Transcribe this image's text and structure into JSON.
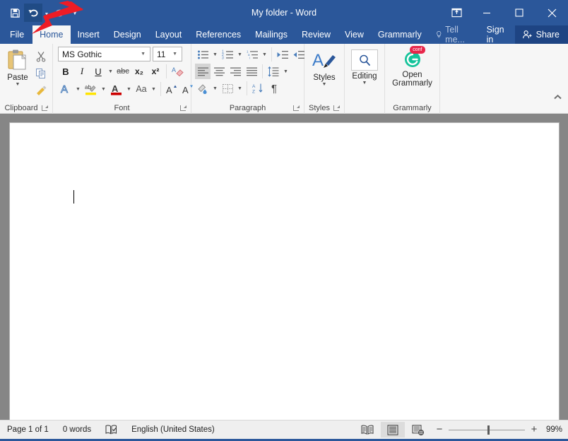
{
  "window": {
    "title": "My folder - Word",
    "quick_access": [
      {
        "name": "save-icon",
        "label": "Save"
      },
      {
        "name": "undo-icon",
        "label": "Undo"
      },
      {
        "name": "redo-icon",
        "label": "Redo"
      },
      {
        "name": "customize-qat-icon",
        "label": "Customize Quick Access Toolbar"
      }
    ],
    "controls": [
      {
        "name": "ribbon-display-options-icon",
        "label": "Ribbon Display Options",
        "glyph": "⤒"
      },
      {
        "name": "minimize-icon",
        "label": "Minimize",
        "glyph": "—"
      },
      {
        "name": "maximize-icon",
        "label": "Maximize",
        "glyph": "□"
      },
      {
        "name": "close-icon",
        "label": "Close",
        "glyph": "✕"
      }
    ]
  },
  "tabs": [
    {
      "label": "File",
      "active": false
    },
    {
      "label": "Home",
      "active": true
    },
    {
      "label": "Insert",
      "active": false
    },
    {
      "label": "Design",
      "active": false
    },
    {
      "label": "Layout",
      "active": false
    },
    {
      "label": "References",
      "active": false
    },
    {
      "label": "Mailings",
      "active": false
    },
    {
      "label": "Review",
      "active": false
    },
    {
      "label": "View",
      "active": false
    },
    {
      "label": "Grammarly",
      "active": false
    }
  ],
  "tabbar_right": {
    "tell_me": "Tell me...",
    "sign_in": "Sign in",
    "share": "Share"
  },
  "ribbon": {
    "groups": [
      {
        "label": "Clipboard",
        "has_launcher": true
      },
      {
        "label": "Font",
        "has_launcher": true
      },
      {
        "label": "Paragraph",
        "has_launcher": true
      },
      {
        "label": "Styles",
        "has_launcher": true
      },
      {
        "label": "Grammarly",
        "has_launcher": false
      }
    ],
    "clipboard": {
      "paste_label": "Paste",
      "buttons": [
        {
          "name": "cut-icon",
          "label": "Cut"
        },
        {
          "name": "copy-icon",
          "label": "Copy"
        },
        {
          "name": "format-painter-icon",
          "label": "Format Painter"
        }
      ]
    },
    "font": {
      "font_name": "MS Gothic",
      "font_size": "11",
      "buttons": [
        {
          "name": "bold-button",
          "label": "B"
        },
        {
          "name": "italic-button",
          "label": "I"
        },
        {
          "name": "underline-button",
          "label": "U"
        },
        {
          "name": "strikethrough-button",
          "label": "abc"
        },
        {
          "name": "subscript-button",
          "label": "x₂"
        },
        {
          "name": "superscript-button",
          "label": "x²"
        },
        {
          "name": "clear-formatting-button",
          "label": "Clear All Formatting"
        },
        {
          "name": "text-effects-button",
          "label": "Text Effects"
        },
        {
          "name": "text-highlight-color-button",
          "label": "Text Highlight Color"
        },
        {
          "name": "font-color-button",
          "label": "Font Color"
        },
        {
          "name": "change-case-button",
          "label": "Aa"
        },
        {
          "name": "grow-font-button",
          "label": "A"
        },
        {
          "name": "shrink-font-button",
          "label": "A"
        }
      ]
    },
    "paragraph": {
      "buttons": [
        {
          "name": "bullets-button",
          "label": "Bullets"
        },
        {
          "name": "numbering-button",
          "label": "Numbering"
        },
        {
          "name": "multilevel-list-button",
          "label": "Multilevel List"
        },
        {
          "name": "decrease-indent-button",
          "label": "Decrease Indent"
        },
        {
          "name": "increase-indent-button",
          "label": "Increase Indent"
        },
        {
          "name": "align-left-button",
          "label": "Align Left",
          "selected": true
        },
        {
          "name": "align-center-button",
          "label": "Center"
        },
        {
          "name": "align-right-button",
          "label": "Align Right"
        },
        {
          "name": "justify-button",
          "label": "Justify"
        },
        {
          "name": "line-spacing-button",
          "label": "Line and Paragraph Spacing"
        },
        {
          "name": "shading-button",
          "label": "Shading"
        },
        {
          "name": "borders-button",
          "label": "Borders"
        },
        {
          "name": "sort-button",
          "label": "Sort"
        },
        {
          "name": "show-formatting-marks-button",
          "label": "¶"
        }
      ]
    },
    "styles": {
      "label": "Styles"
    },
    "editing": {
      "label": "Editing"
    },
    "grammarly": {
      "label_line1": "Open",
      "label_line2": "Grammarly",
      "badge": "conf"
    },
    "collapse_label": "Collapse the Ribbon"
  },
  "document": {
    "page_label": "",
    "content": ""
  },
  "status": {
    "page": "Page 1 of 1",
    "words": "0 words",
    "proofing_icon": "proofing-errors-icon",
    "language": "English (United States)",
    "views": [
      {
        "name": "read-mode-button",
        "label": "Read Mode",
        "active": false
      },
      {
        "name": "print-layout-button",
        "label": "Print Layout",
        "active": true
      },
      {
        "name": "web-layout-button",
        "label": "Web Layout",
        "active": false
      }
    ],
    "zoom_out": "−",
    "zoom_in": "+",
    "zoom_level": "99%"
  },
  "annotation": {
    "arrow_name": "red-arrow-pointing-to-file-tab",
    "color": "#ee1c25"
  }
}
